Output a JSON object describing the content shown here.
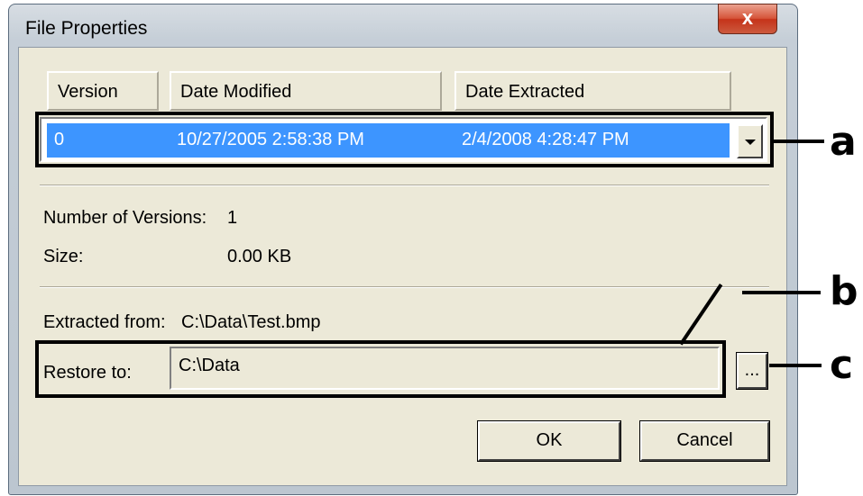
{
  "window": {
    "title": "File Properties",
    "close_label": "x"
  },
  "columns": [
    "Version",
    "Date Modified",
    "Date Extracted"
  ],
  "versions_combo": {
    "selected": {
      "version": "0",
      "date_modified": "10/27/2005 2:58:38 PM",
      "date_extracted": "2/4/2008 4:28:47 PM"
    }
  },
  "info": {
    "num_versions_label": "Number of Versions:",
    "num_versions_value": "1",
    "size_label": "Size:",
    "size_value": "0.00 KB",
    "extracted_from_label": "Extracted from:",
    "extracted_from_value": "C:\\Data\\Test.bmp"
  },
  "restore": {
    "label": "Restore to:",
    "path": "C:\\Data",
    "browse_label": "..."
  },
  "buttons": {
    "ok": "OK",
    "cancel": "Cancel"
  },
  "annotations": {
    "a": "a",
    "b": "b",
    "c": "c"
  }
}
